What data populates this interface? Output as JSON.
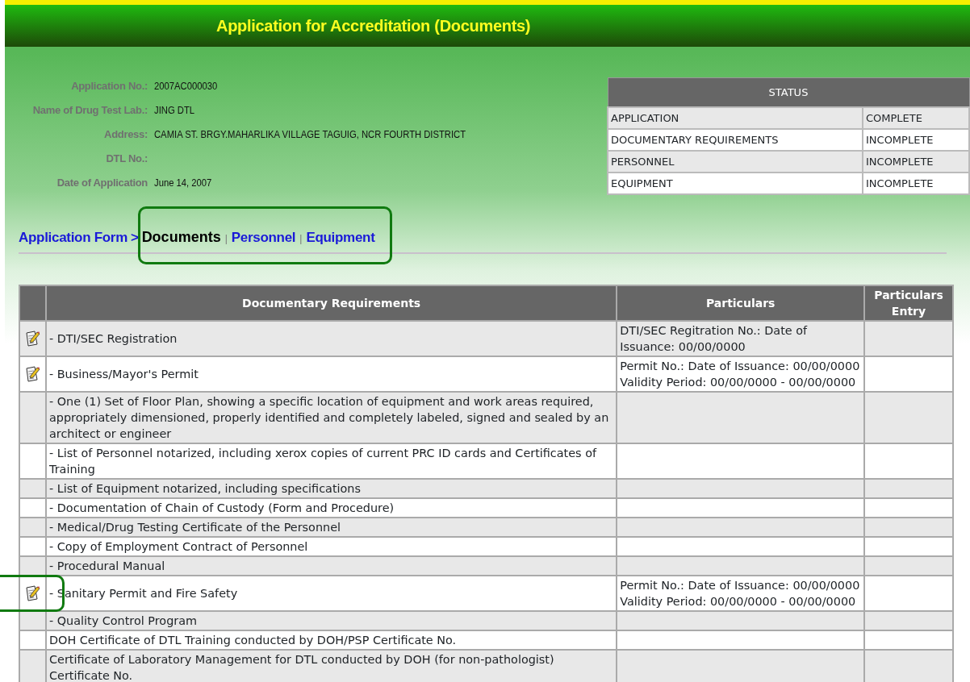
{
  "header": {
    "title": "Application for Accreditation (Documents)"
  },
  "info": [
    {
      "label": "Application No.:",
      "value": "2007AC000030"
    },
    {
      "label": "Name of Drug Test Lab.:",
      "value": "JING DTL"
    },
    {
      "label": "Address:",
      "value": "CAMIA ST. BRGY.MAHARLIKA VILLAGE TAGUIG, NCR FOURTH DISTRICT"
    },
    {
      "label": "DTL No.:"
    },
    {
      "label": "Date of Application",
      "value": "June 14, 2007"
    }
  ],
  "status": {
    "title": "STATUS",
    "rows": [
      {
        "item": "APPLICATION",
        "state": "COMPLETE"
      },
      {
        "item": "DOCUMENTARY REQUIREMENTS",
        "state": "INCOMPLETE"
      },
      {
        "item": "PERSONNEL",
        "state": "INCOMPLETE"
      },
      {
        "item": "EQUIPMENT",
        "state": "INCOMPLETE"
      }
    ]
  },
  "breadcrumb": {
    "root": "Application Form",
    "separator": ">",
    "highlighted": true,
    "tabs": [
      {
        "label": "Documents",
        "selected": true
      },
      {
        "label": "Personnel",
        "selected": false
      },
      {
        "label": "Equipment",
        "selected": false
      }
    ],
    "divider": "|"
  },
  "table": {
    "columns": [
      "Documentary Requirements",
      "Particulars",
      "Particulars Entry"
    ],
    "rows": [
      {
        "editable": true,
        "text": "- DTI/SEC Registration",
        "particulars": "DTI/SEC Regitration No.: Date of Issuance: 00/00/0000"
      },
      {
        "editable": true,
        "text": "- Business/Mayor's Permit",
        "particulars": "Permit No.: Date of Issuance: 00/00/0000 Validity Period: 00/00/0000 - 00/00/0000"
      },
      {
        "editable": false,
        "text": "- One (1) Set of Floor Plan, showing a specific location of equipment and work areas required, appropriately dimensioned, properly identified and completely labeled, signed and sealed by an architect or engineer"
      },
      {
        "editable": false,
        "text": "- List of Personnel notarized, including xerox copies of current PRC ID cards and Certificates of Training"
      },
      {
        "editable": false,
        "text": "- List of Equipment notarized, including specifications"
      },
      {
        "editable": false,
        "text": "- Documentation of Chain of Custody (Form and Procedure)"
      },
      {
        "editable": false,
        "text": "- Medical/Drug Testing Certificate of the Personnel"
      },
      {
        "editable": false,
        "text": "- Copy of Employment Contract of Personnel"
      },
      {
        "editable": false,
        "text": "- Procedural Manual"
      },
      {
        "editable": true,
        "highlighted": true,
        "text": "- Sanitary Permit and Fire Safety",
        "particulars": "Permit No.: Date of Issuance: 00/00/0000 Validity Period: 00/00/0000 - 00/00/0000"
      },
      {
        "editable": false,
        "text": "- Quality Control Program"
      },
      {
        "editable": false,
        "text": "DOH Certificate of DTL Training conducted by DOH/PSP Certificate No."
      },
      {
        "editable": false,
        "text": "Certificate of Laboratory Management for DTL conducted by DOH (for non-pathologist) Certificate No."
      }
    ]
  }
}
